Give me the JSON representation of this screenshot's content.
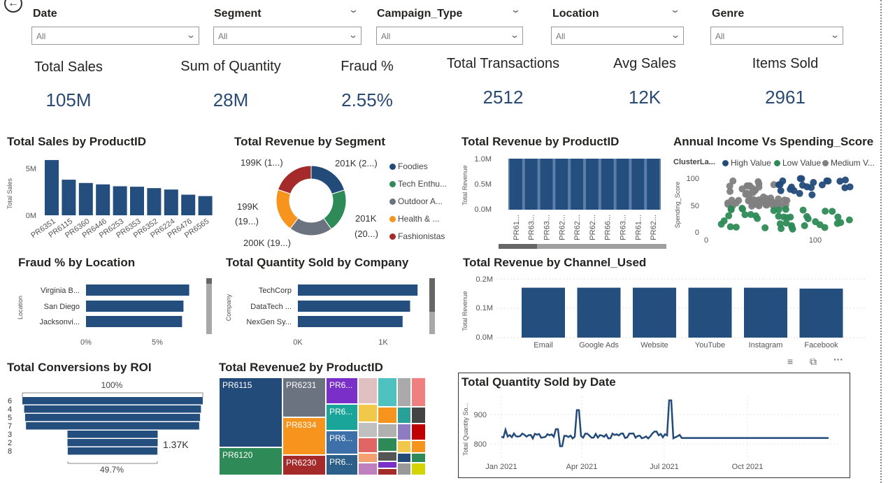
{
  "filters": [
    {
      "title": "Date",
      "value": "All"
    },
    {
      "title": "Segment",
      "value": "All"
    },
    {
      "title": "Campaign_Type",
      "value": "All"
    },
    {
      "title": "Location",
      "value": "All"
    },
    {
      "title": "Genre",
      "value": "All"
    }
  ],
  "kpis": [
    {
      "label": "Total Sales",
      "value": "105M"
    },
    {
      "label": "Sum of Quantity",
      "value": "28M"
    },
    {
      "label": "Fraud %",
      "value": "2.55%"
    },
    {
      "label": "Total Transactions",
      "value": "2512"
    },
    {
      "label": "Avg Sales",
      "value": "12K"
    },
    {
      "label": "Items Sold",
      "value": "2961"
    }
  ],
  "colors": {
    "navy": "#234b7a",
    "teal": "#1f7a5a",
    "green": "#2e8b57",
    "gray": "#6b7280",
    "orange": "#f7941d",
    "red": "#a52a2a",
    "bar": "#244e7d"
  },
  "sales_by_product": {
    "title": "Total Sales by ProductID",
    "ylabel": "Total Sales",
    "yticks": [
      "5M",
      "0M"
    ],
    "categories": [
      "PR6351",
      "PR6115",
      "PR6360",
      "PR6446",
      "PR6253",
      "PR6353",
      "PR6352",
      "PR6224",
      "PR6476",
      "PR6565"
    ],
    "values": [
      5.9,
      3.8,
      3.45,
      3.3,
      3.1,
      3.05,
      2.9,
      2.75,
      2.2,
      2.05
    ]
  },
  "revenue_by_segment": {
    "title": "Total Revenue by Segment",
    "labels": [
      "199K (1...)",
      "201K (2...)",
      "199K",
      "(19...)",
      "201K",
      "(20...)",
      "200K (19...)"
    ],
    "legend": [
      {
        "name": "Foodies",
        "color": "#234b7a"
      },
      {
        "name": "Tech Enthu...",
        "color": "#2e8b57"
      },
      {
        "name": "Outdoor A...",
        "color": "#6b7280"
      },
      {
        "name": "Health & ...",
        "color": "#f7941d"
      },
      {
        "name": "Fashionistas",
        "color": "#a52a2a"
      }
    ],
    "values": [
      201,
      201,
      200,
      199,
      199
    ]
  },
  "revenue_by_product": {
    "title": "Total Revenue by ProductID",
    "ylabel": "Total Revenue",
    "yticks": [
      "1.0M",
      "0.5M",
      "0.0M"
    ],
    "categories": [
      "PR61...",
      "PR63...",
      "PR63...",
      "PR62...",
      "PR62...",
      "PR62...",
      "PR66...",
      "PR63...",
      "PR61...",
      "PR62..."
    ]
  },
  "income_vs_spending": {
    "title": "Annual Income Vs Spending_Score",
    "legend_title": "ClusterLa...",
    "legend": [
      {
        "name": "High Value",
        "color": "#234b7a"
      },
      {
        "name": "Low Value",
        "color": "#2e8b57"
      },
      {
        "name": "Medium V...",
        "color": "#808080"
      }
    ],
    "ylabel": "Spending_Score",
    "yticks": [
      "100",
      "50",
      "0"
    ],
    "xticks": [
      "0",
      "100"
    ]
  },
  "fraud_by_location": {
    "title": "Fraud % by Location",
    "ylabel": "Location",
    "categories": [
      "Virginia B...",
      "San Diego",
      "Jacksonvi..."
    ],
    "values": [
      7.2,
      6.8,
      6.7
    ],
    "xticks": [
      "0%",
      "5%"
    ]
  },
  "quantity_by_company": {
    "title": "Total Quantity Sold by Company",
    "ylabel": "Company",
    "categories": [
      "TechCorp",
      "DataTech ...",
      "NexGen Sy..."
    ],
    "values": [
      1.6,
      1.5,
      1.4
    ],
    "xticks": [
      "0K",
      "1K"
    ]
  },
  "revenue_by_channel": {
    "title": "Total Revenue by Channel_Used",
    "ylabel": "Total Revenue",
    "yticks": [
      "0.2M",
      "0.1M",
      "0.0M"
    ],
    "categories": [
      "Email",
      "Google Ads",
      "Website",
      "YouTube",
      "Instagram",
      "Facebook"
    ],
    "values": [
      0.17,
      0.17,
      0.17,
      0.17,
      0.17,
      0.167
    ]
  },
  "conversions_by_roi": {
    "title": "Total Conversions by ROI",
    "top_label": "100%",
    "bottom_label": "49.7%",
    "value_label": "1.37K",
    "categories": [
      "6",
      "4",
      "5",
      "7",
      "3",
      "2",
      "8"
    ],
    "values": [
      100,
      98,
      97,
      96,
      50,
      50,
      49.7
    ]
  },
  "revenue2_by_product": {
    "title": "Total Revenue2 by ProductID",
    "cells": [
      "PR6115",
      "PR6120",
      "PR6231",
      "PR6334",
      "PR6230",
      "PR6...",
      "PR6...",
      "PR6...",
      "PR6..."
    ]
  },
  "quantity_by_date": {
    "title": "Total Quantity Sold by Date",
    "ylabel": "Total Quantity So...",
    "yticks": [
      "900",
      "800"
    ],
    "xticks": [
      "Jan 2021",
      "Apr 2021",
      "Jul 2021",
      "Oct 2021"
    ]
  }
}
